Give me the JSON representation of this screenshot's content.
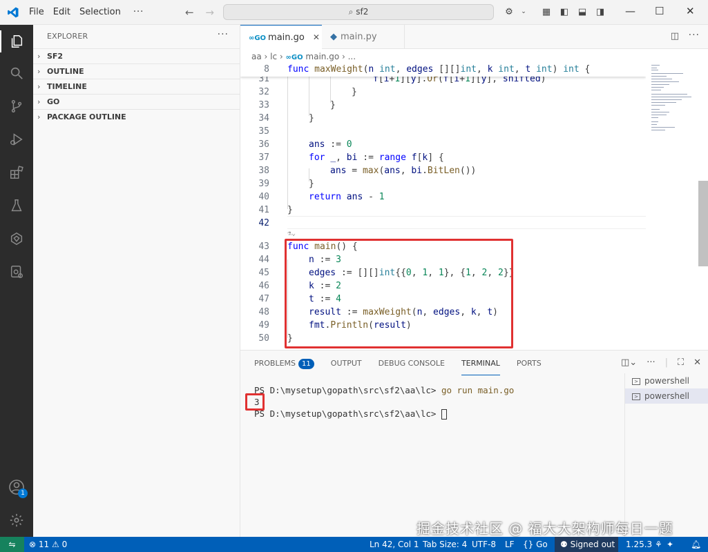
{
  "titlebar": {
    "menus": [
      "File",
      "Edit",
      "Selection"
    ],
    "search": "sf2"
  },
  "sidebar": {
    "title": "EXPLORER",
    "sections": [
      "SF2",
      "OUTLINE",
      "TIMELINE",
      "GO",
      "PACKAGE OUTLINE"
    ]
  },
  "activity": {
    "accounts_badge": "1"
  },
  "tabs": [
    {
      "label": "main.go",
      "active": true
    },
    {
      "label": "main.py",
      "active": false
    }
  ],
  "breadcrumb": {
    "parts": [
      "aa",
      "lc",
      "main.go",
      "..."
    ]
  },
  "editor": {
    "sticky": {
      "line": "8",
      "text": "func maxWeight(n int, edges [][]int, k int, t int) int {"
    },
    "lines": [
      {
        "n": "31",
        "text": "f[i+1][y].Or(f[i+1][y], shifted)"
      },
      {
        "n": "32",
        "text": "}"
      },
      {
        "n": "33",
        "text": "}"
      },
      {
        "n": "34",
        "text": "}"
      },
      {
        "n": "35",
        "text": ""
      },
      {
        "n": "36",
        "text": "ans := 0"
      },
      {
        "n": "37",
        "text": "for _, bi := range f[k] {"
      },
      {
        "n": "38",
        "text": "ans = max(ans, bi.BitLen())"
      },
      {
        "n": "39",
        "text": "}"
      },
      {
        "n": "40",
        "text": "return ans - 1"
      },
      {
        "n": "41",
        "text": "}"
      },
      {
        "n": "42",
        "text": ""
      },
      {
        "n": "43",
        "text": "func main() {"
      },
      {
        "n": "44",
        "text": "n := 3"
      },
      {
        "n": "45",
        "text": "edges := [][]int{{0, 1, 1}, {1, 2, 2}}"
      },
      {
        "n": "46",
        "text": "k := 2"
      },
      {
        "n": "47",
        "text": "t := 4"
      },
      {
        "n": "48",
        "text": "result := maxWeight(n, edges, k, t)"
      },
      {
        "n": "49",
        "text": "fmt.Println(result)"
      },
      {
        "n": "50",
        "text": "}"
      }
    ]
  },
  "panel": {
    "tabs": [
      "PROBLEMS",
      "OUTPUT",
      "DEBUG CONSOLE",
      "TERMINAL",
      "PORTS"
    ],
    "problems_count": "11",
    "terminal": {
      "prompt1": "PS D:\\mysetup\\gopath\\src\\sf2\\aa\\lc>",
      "command": "go run main.go",
      "output": "3",
      "prompt2": "PS D:\\mysetup\\gopath\\src\\sf2\\aa\\lc>"
    },
    "terminals": [
      "powershell",
      "powershell"
    ]
  },
  "watermark": "掘金技术社区 @ 福大大架构师每日一题",
  "status": {
    "errors": "11",
    "warnings": "0",
    "position": "Ln 42, Col 1",
    "tab_size": "Tab Size: 4",
    "encoding": "UTF-8",
    "eol": "LF",
    "language": "Go",
    "account": "Signed out",
    "version": "1.25.3"
  },
  "colors": {
    "accent": "#005fb8",
    "highlight": "#e03131",
    "activity_bg": "#2c2c2c"
  }
}
